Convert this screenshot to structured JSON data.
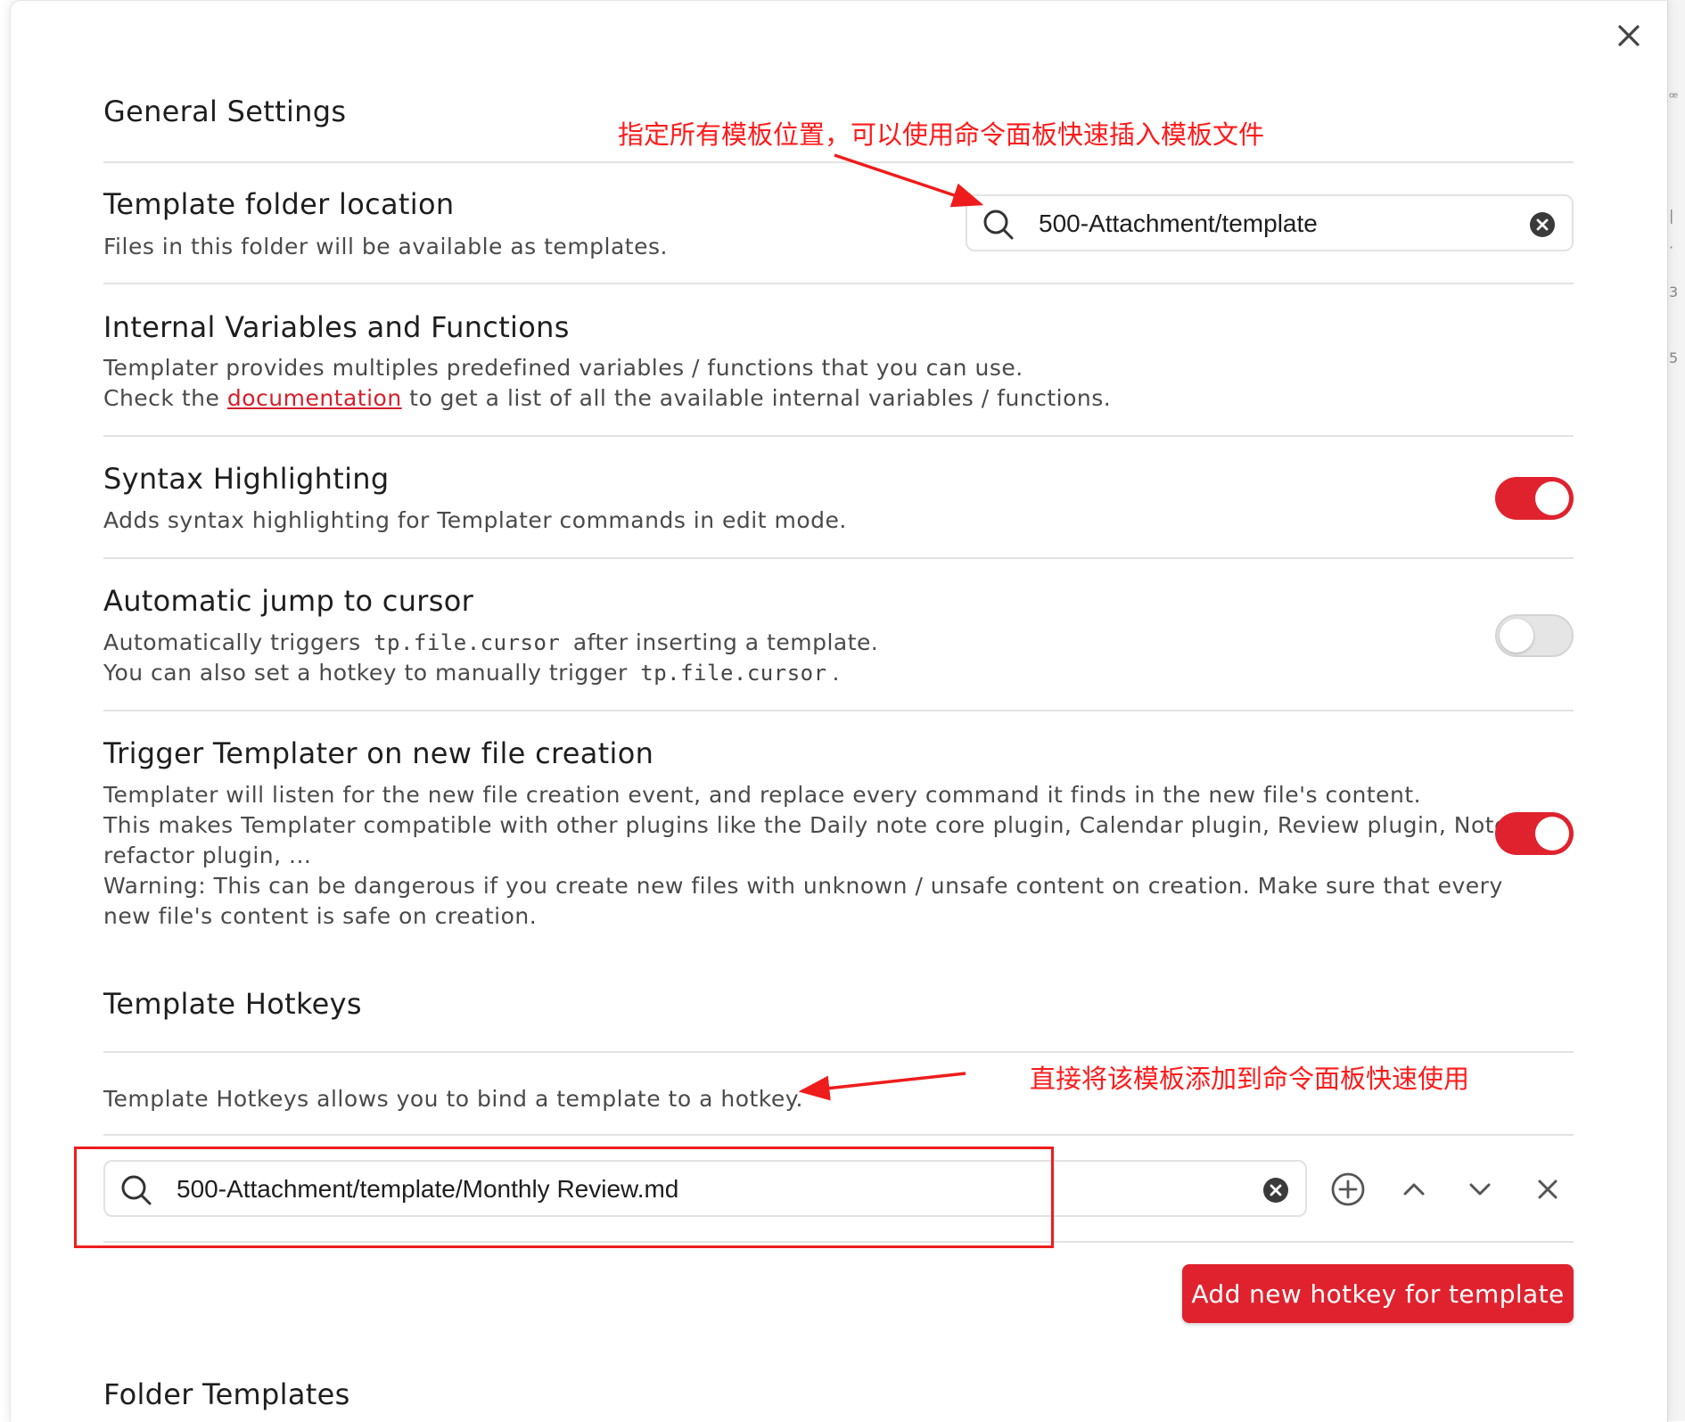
{
  "colors": {
    "accent": "#e0222e",
    "annotation": "#ff1a1a",
    "divider": "#e3e3e3"
  },
  "general": {
    "heading": "General Settings"
  },
  "template_folder": {
    "name": "Template folder location",
    "desc": "Files in this folder will be available as templates.",
    "value": "500-Attachment/template",
    "search_icon": "search-icon",
    "clear_icon": "clear-circle-icon"
  },
  "internal_vars": {
    "name": "Internal Variables and Functions",
    "line1": "Templater provides multiples predefined variables / functions that you can use.",
    "line2_before": "Check the",
    "link": "documentation",
    "line2_after": "to get a list of all the available internal variables / functions."
  },
  "syntax": {
    "name": "Syntax Highlighting",
    "desc": "Adds syntax highlighting for Templater commands in edit mode.",
    "enabled": true
  },
  "auto_jump": {
    "name": "Automatic jump to cursor",
    "line1_before": "Automatically triggers",
    "line1_code": "tp.file.cursor",
    "line1_after": "after inserting a template.",
    "line2_before": "You can also set a hotkey to manually trigger",
    "line2_code": "tp.file.cursor",
    "line2_after": ".",
    "enabled": false
  },
  "trigger": {
    "name": "Trigger Templater on new file creation",
    "line1": "Templater will listen for the new file creation event, and replace every command it finds in the new file's content.",
    "line2": "This makes Templater compatible with other plugins like the Daily note core plugin, Calendar plugin, Review plugin, Note",
    "line3": "refactor plugin, ...",
    "line4": "Warning: This can be dangerous if you create new files with unknown / unsafe content on creation. Make sure that every",
    "line5": "new file's content is safe on creation.",
    "enabled": true
  },
  "hotkeys": {
    "heading": "Template Hotkeys",
    "desc": "Template Hotkeys allows you to bind a template to a hotkey.",
    "entry_value": "500-Attachment/template/Monthly Review.md",
    "add_button": "Add new hotkey for template",
    "action_icons": [
      "plus-circle-icon",
      "chevron-up-icon",
      "chevron-down-icon",
      "close-icon"
    ]
  },
  "folder_templates": {
    "heading": "Folder Templates"
  },
  "annotations": {
    "top": "指定所有模板位置，可以使用命令面板快速插入模板文件",
    "middle": "直接将该模板添加到命令面板快速使用"
  },
  "modal": {
    "close_icon": "close-icon"
  }
}
